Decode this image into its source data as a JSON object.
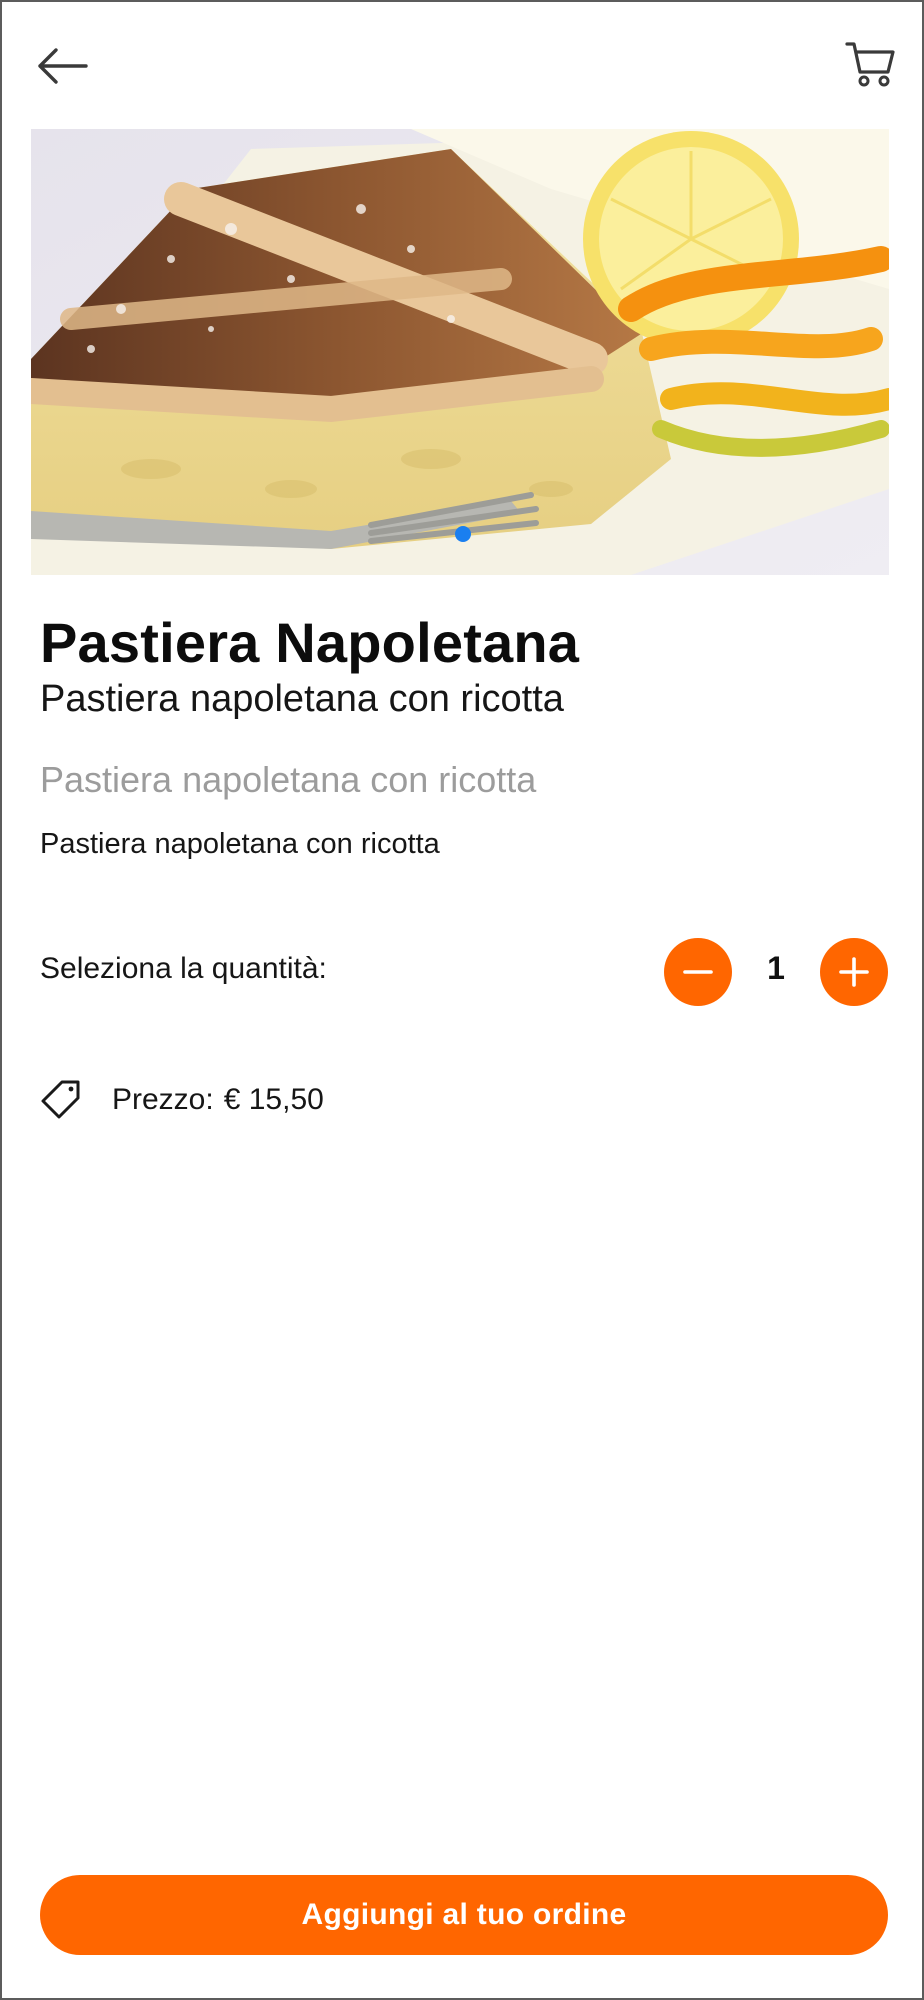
{
  "header": {
    "back_icon": "arrow-left-icon",
    "cart_icon": "cart-icon"
  },
  "product": {
    "name": "Pastiera Napoletana",
    "subtitle": "Pastiera napoletana con ricotta",
    "description_muted": "Pastiera napoletana con ricotta",
    "description": "Pastiera napoletana con ricotta"
  },
  "gallery": {
    "image_subject": "slice of pastiera cake with lemon and orange peel",
    "slide_count": 1,
    "active_slide": 1
  },
  "quantity": {
    "label": "Seleziona la quantità:",
    "value": "1",
    "minus_icon": "minus-icon",
    "plus_icon": "plus-icon"
  },
  "price": {
    "icon": "price-tag-icon",
    "label": "Prezzo:",
    "value": "€ 15,50"
  },
  "cta": {
    "label": "Aggiungi al tuo ordine"
  },
  "colors": {
    "accent": "#ff6600",
    "dot_active": "#1a7ff0",
    "muted_text": "#9c9c9c"
  }
}
